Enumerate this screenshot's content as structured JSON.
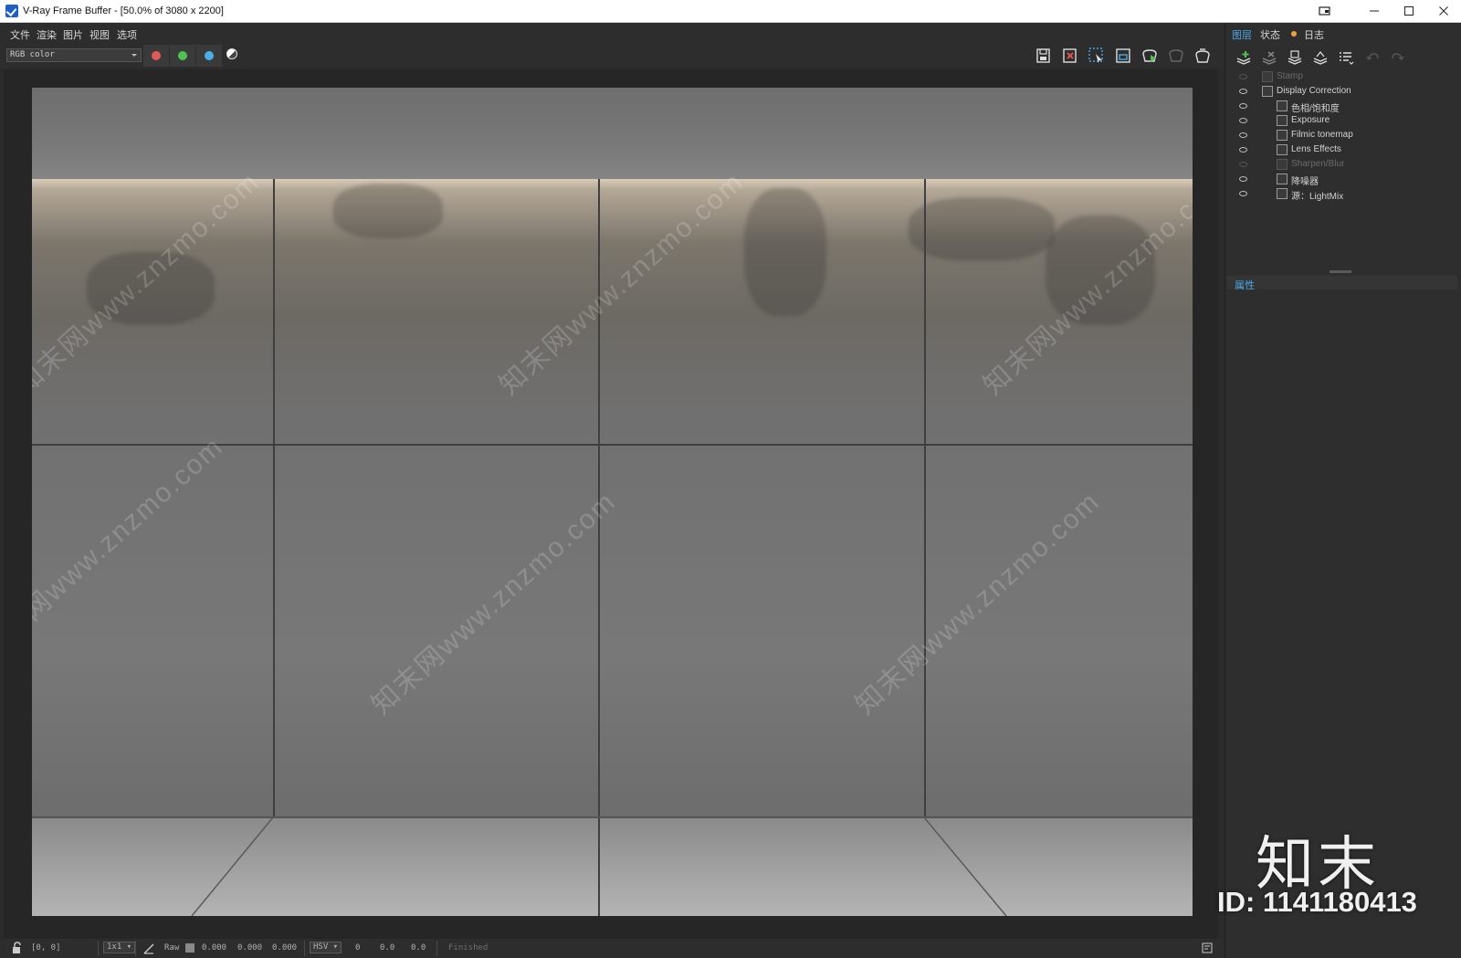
{
  "window": {
    "title": "V-Ray Frame Buffer - [50.0% of 3080 x 2200]",
    "controls": [
      "cast-icon",
      "minimize-icon",
      "maximize-icon",
      "close-icon"
    ]
  },
  "menu": [
    "文件",
    "渲染",
    "图片",
    "视图",
    "选项"
  ],
  "toolbar": {
    "channel": "RGB color",
    "channel_buttons": [
      {
        "name": "red-channel",
        "color": "#e05a5a"
      },
      {
        "name": "green-channel",
        "color": "#4fc24f"
      },
      {
        "name": "blue-channel",
        "color": "#4aaee8"
      }
    ],
    "right_icons": [
      "save-icon",
      "clear-image-icon",
      "region-render-icon",
      "toggle-display-icon",
      "render-interactive-icon",
      "render-icon",
      "render-teapot-icon"
    ]
  },
  "watermarks": [
    "知末网www.znzmo.com"
  ],
  "status": {
    "coords": "[0, 0]",
    "zoom": "1x1",
    "raw_label": "Raw",
    "raw_values": [
      "0.000",
      "0.000",
      "0.000"
    ],
    "mode": "HSV",
    "hsv_values": [
      "0",
      "0.0",
      "0.0"
    ],
    "message": "Finished"
  },
  "panel": {
    "tabs": [
      "图层",
      "状态",
      "日志"
    ],
    "layers": [
      {
        "name": "Stamp",
        "enabled": false,
        "indent": 0
      },
      {
        "name": "Display Correction",
        "enabled": true,
        "indent": 0
      },
      {
        "name": "色相/饱和度",
        "enabled": true,
        "indent": 1
      },
      {
        "name": "Exposure",
        "enabled": true,
        "indent": 1
      },
      {
        "name": "Filmic tonemap",
        "enabled": true,
        "indent": 1
      },
      {
        "name": "Lens Effects",
        "enabled": true,
        "indent": 1
      },
      {
        "name": "Sharpen/Blur",
        "enabled": false,
        "indent": 1
      },
      {
        "name": "降噪器",
        "enabled": true,
        "indent": 1
      },
      {
        "name": "源：LightMix",
        "enabled": true,
        "indent": 1
      }
    ],
    "properties_title": "属性"
  },
  "brand": {
    "name": "知末",
    "id": "ID: 1141180413"
  }
}
